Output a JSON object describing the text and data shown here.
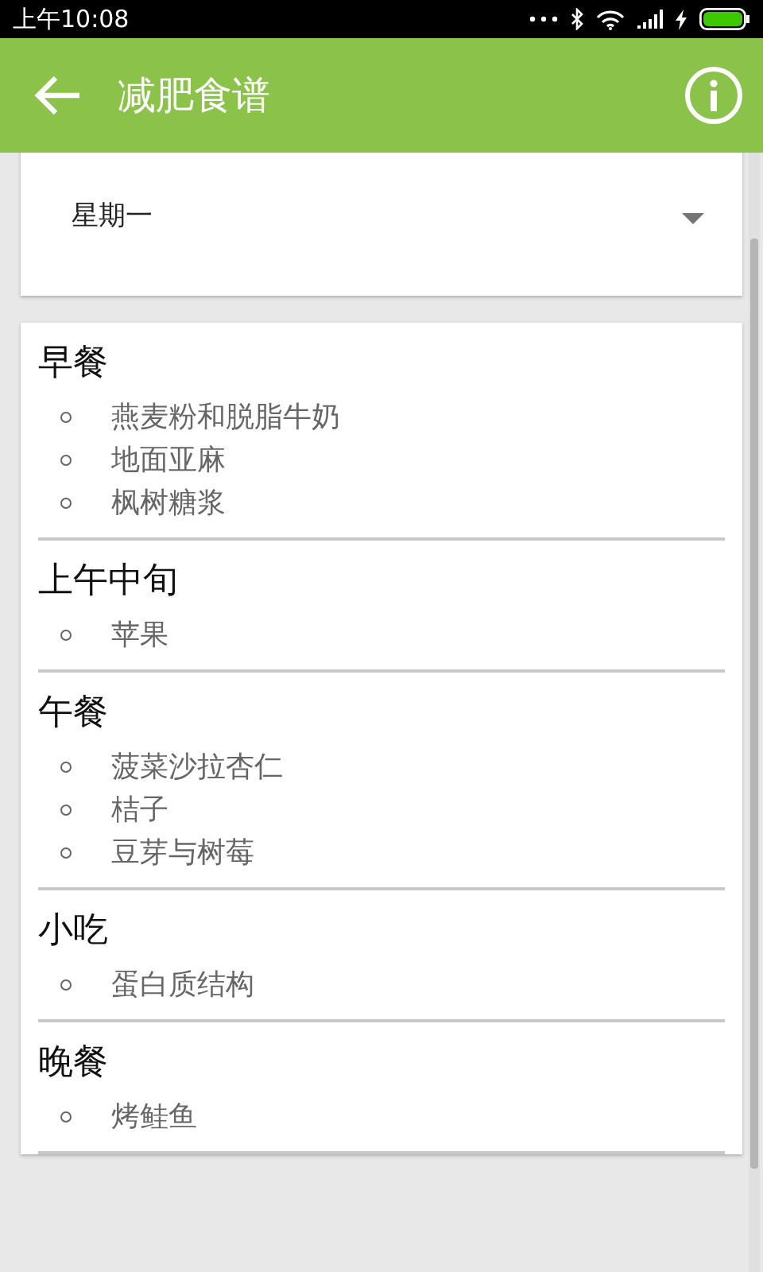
{
  "status_bar": {
    "time": "上午10:08"
  },
  "app_bar": {
    "title": "减肥食谱"
  },
  "day_selector": {
    "value": "星期一"
  },
  "meals": [
    {
      "title": "早餐",
      "items": [
        "燕麦粉和脱脂牛奶",
        "地面亚麻",
        "枫树糖浆"
      ]
    },
    {
      "title": "上午中旬",
      "items": [
        "苹果"
      ]
    },
    {
      "title": "午餐",
      "items": [
        "菠菜沙拉杏仁",
        "桔子",
        "豆芽与树莓"
      ]
    },
    {
      "title": "小吃",
      "items": [
        "蛋白质结构"
      ]
    },
    {
      "title": "晚餐",
      "items": [
        "烤鲑鱼"
      ]
    }
  ]
}
